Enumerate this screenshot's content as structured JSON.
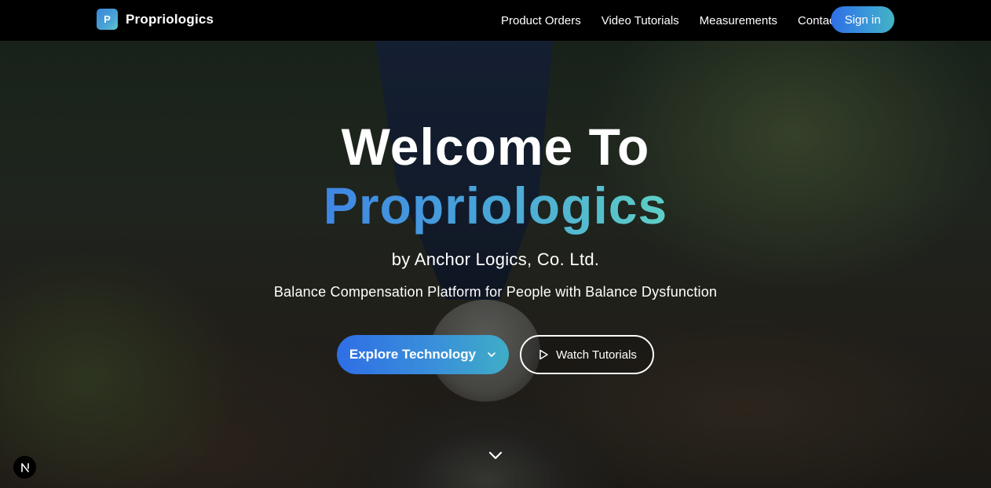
{
  "brand": {
    "logo_letter": "P",
    "name": "Propriologics"
  },
  "nav": {
    "links": [
      {
        "label": "Product Orders"
      },
      {
        "label": "Video Tutorials"
      },
      {
        "label": "Measurements"
      },
      {
        "label": "Contact"
      }
    ],
    "signin_label": "Sign in"
  },
  "hero": {
    "title_line1": "Welcome To",
    "title_line2": "Propriologics",
    "byline": "by Anchor Logics, Co. Ltd.",
    "tagline": "Balance Compensation Platform for People with Balance Dysfunction",
    "explore_label": "Explore Technology",
    "watch_label": "Watch Tutorials"
  },
  "icons": {
    "explore": "chevron-down-icon",
    "watch": "play-icon",
    "scroll": "chevron-down-icon",
    "badge": "next-logo-icon"
  },
  "colors": {
    "accent_blue": "#2f6ee6",
    "accent_teal": "#5fcfc6",
    "nav_bg": "#000000",
    "text": "#ffffff"
  }
}
